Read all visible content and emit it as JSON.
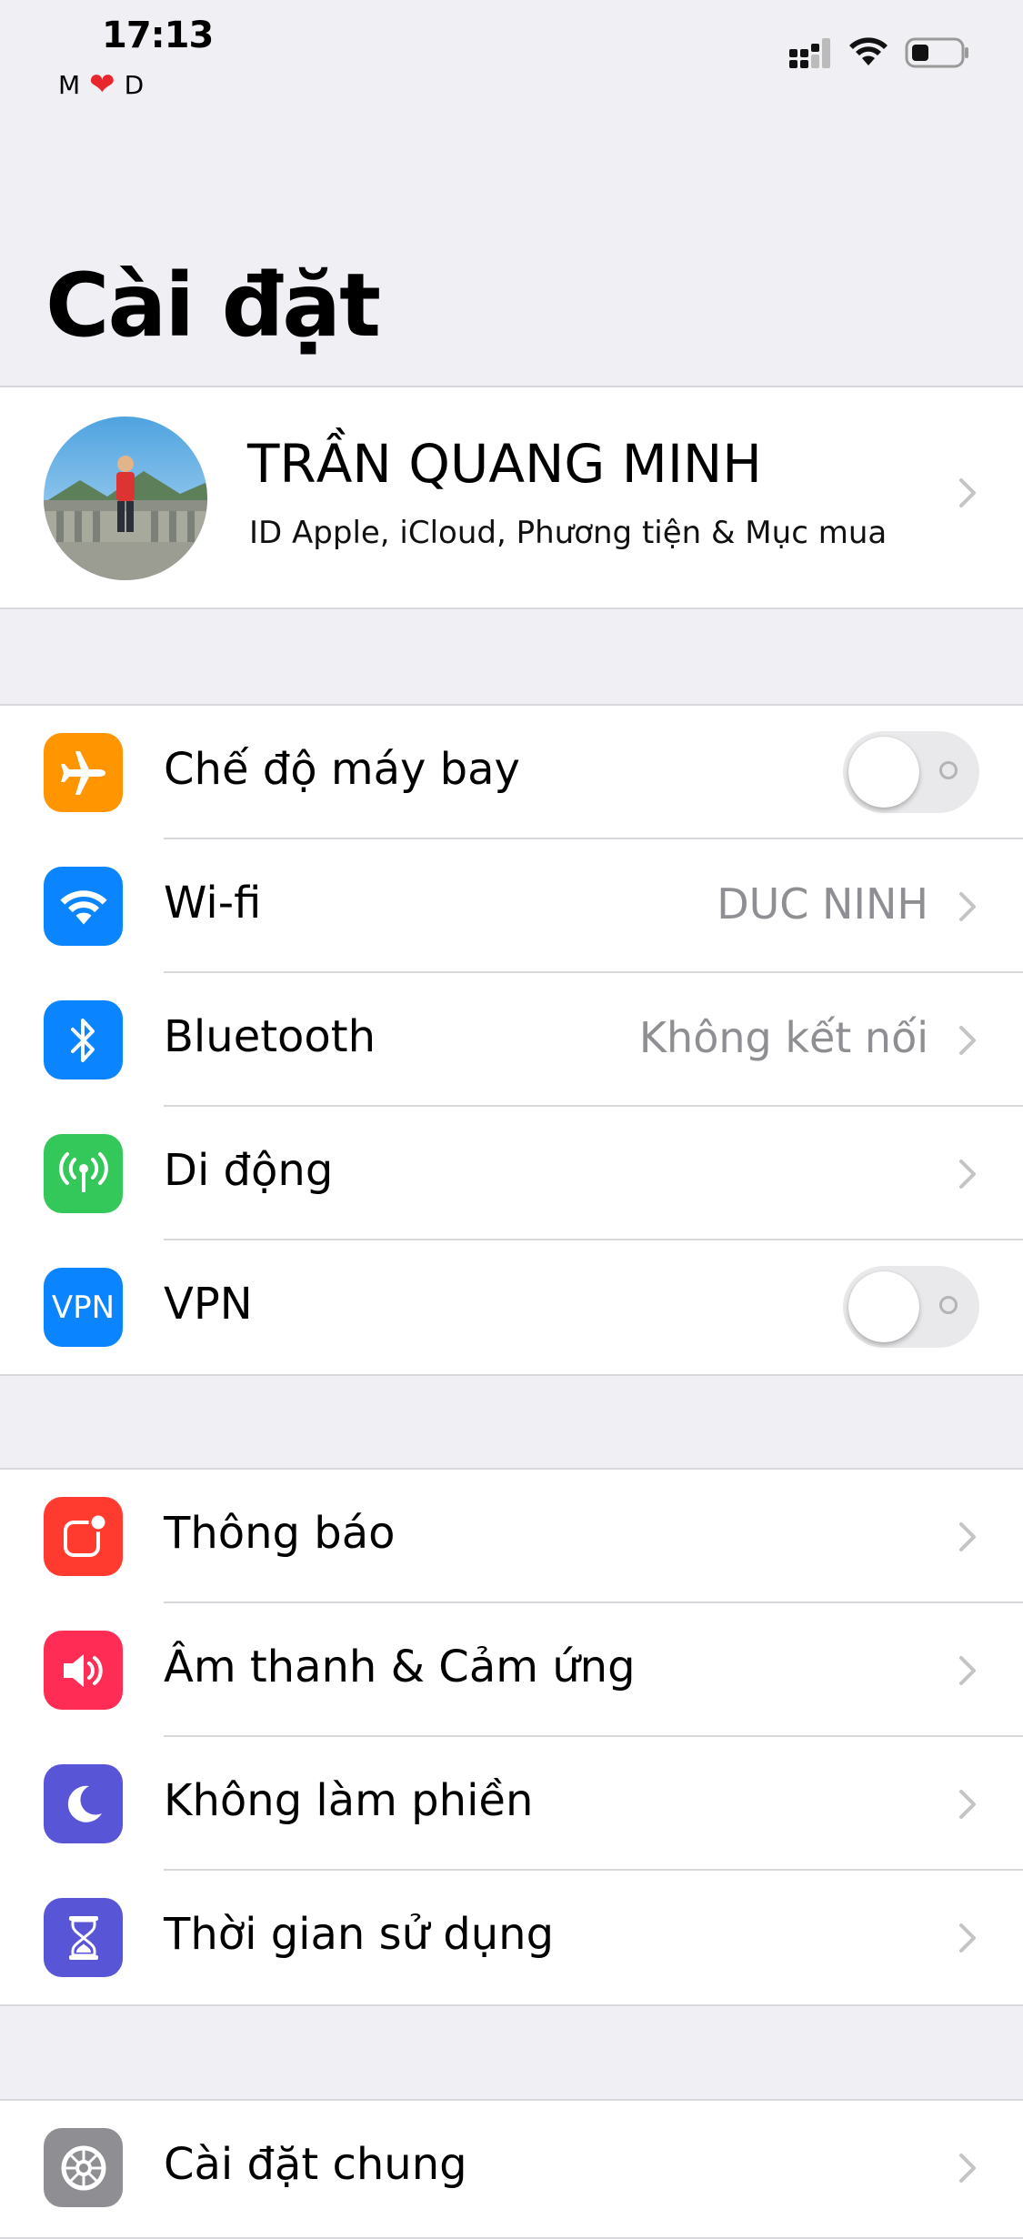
{
  "status_bar": {
    "time": "17:13",
    "carrier_left": "M",
    "carrier_right": "D",
    "carrier_heart": "❤",
    "icons": [
      "signal-icon",
      "wifi-icon",
      "battery-icon"
    ]
  },
  "page": {
    "title": "Cài đặt"
  },
  "profile": {
    "name": "TRẦN QUANG MINH",
    "subtitle": "ID Apple, iCloud, Phương tiện & Mục mua"
  },
  "connectivity": {
    "items": [
      {
        "label": "Chế độ máy bay",
        "icon": "airplane-icon",
        "icon_bg": "#ff9500",
        "control": "toggle",
        "on": false
      },
      {
        "label": "Wi-fi",
        "value": "DUC NINH",
        "icon": "wifi-icon",
        "icon_bg": "#0a84ff"
      },
      {
        "label": "Bluetooth",
        "value": "Không kết nối",
        "icon": "bluetooth-icon",
        "icon_bg": "#0a84ff"
      },
      {
        "label": "Di động",
        "icon": "cellular-antenna-icon",
        "icon_bg": "#34c759"
      },
      {
        "label": "VPN",
        "icon_text": "VPN",
        "icon": "vpn-icon",
        "icon_bg": "#0a84ff",
        "control": "toggle",
        "on": false
      }
    ]
  },
  "notifications": {
    "items": [
      {
        "label": "Thông báo",
        "icon": "notifications-icon",
        "icon_bg": "#ff3b30"
      },
      {
        "label": "Âm thanh & Cảm ứng",
        "icon": "speaker-icon",
        "icon_bg": "#ff2d55"
      },
      {
        "label": "Không làm phiền",
        "icon": "moon-icon",
        "icon_bg": "#5856d6"
      },
      {
        "label": "Thời gian sử dụng",
        "icon": "hourglass-icon",
        "icon_bg": "#5856d6"
      }
    ]
  },
  "general": {
    "items": [
      {
        "label": "Cài đặt chung",
        "icon": "gear-icon",
        "icon_bg": "#8e8e93"
      }
    ]
  }
}
